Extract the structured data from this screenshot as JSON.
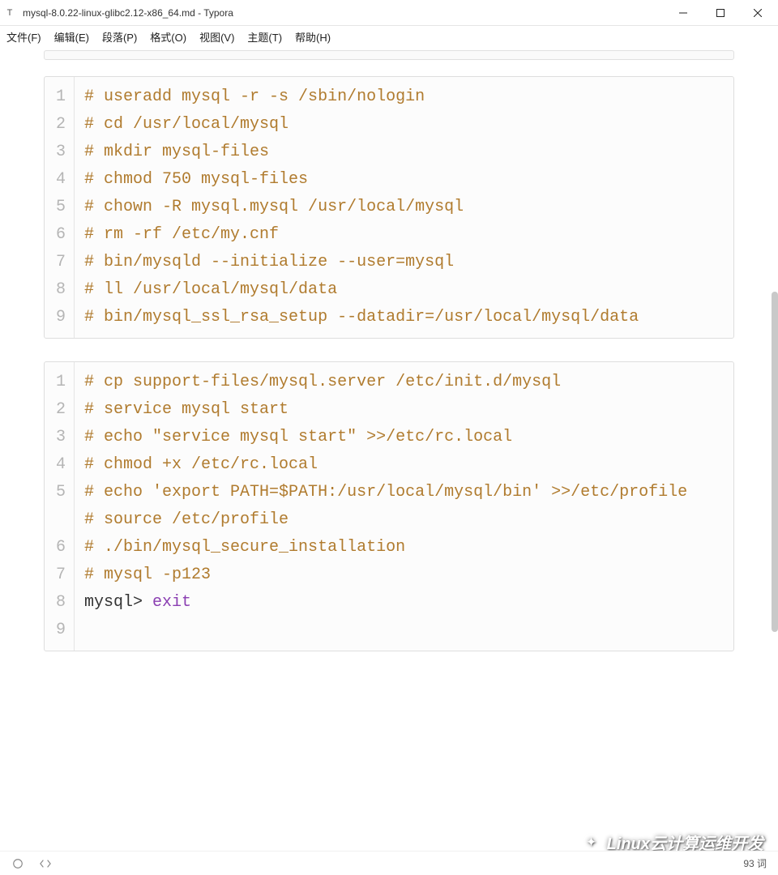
{
  "window": {
    "app_icon_label": "T",
    "title": "mysql-8.0.22-linux-glibc2.12-x86_64.md - Typora"
  },
  "menu": {
    "file": "文件(F)",
    "edit": "编辑(E)",
    "paragraph": "段落(P)",
    "format": "格式(O)",
    "view": "视图(V)",
    "theme": "主题(T)",
    "help": "帮助(H)"
  },
  "code_block_1": {
    "gutter": [
      "1",
      "2",
      "3",
      "4",
      "5",
      "6",
      "7",
      "8",
      "9"
    ],
    "lines": [
      {
        "type": "comment",
        "text": "# useradd mysql -r -s /sbin/nologin"
      },
      {
        "type": "comment",
        "text": "# cd /usr/local/mysql"
      },
      {
        "type": "comment",
        "text": "# mkdir mysql-files"
      },
      {
        "type": "comment",
        "text": "# chmod 750 mysql-files"
      },
      {
        "type": "comment",
        "text": "# chown -R mysql.mysql /usr/local/mysql"
      },
      {
        "type": "comment",
        "text": "# rm -rf /etc/my.cnf"
      },
      {
        "type": "comment",
        "text": "# bin/mysqld --initialize --user=mysql"
      },
      {
        "type": "comment",
        "text": "# ll /usr/local/mysql/data"
      },
      {
        "type": "comment",
        "text": "# bin/mysql_ssl_rsa_setup --datadir=/usr/local/mysql/data"
      }
    ]
  },
  "code_block_2": {
    "gutter": [
      "1",
      "2",
      "3",
      "4",
      "5",
      "",
      "6",
      "7",
      "8",
      "9"
    ],
    "lines": [
      {
        "type": "comment",
        "text": "# cp support-files/mysql.server /etc/init.d/mysql"
      },
      {
        "type": "comment",
        "text": "# service mysql start"
      },
      {
        "type": "comment",
        "text": "# echo \"service mysql start\" >>/etc/rc.local"
      },
      {
        "type": "comment",
        "text": "# chmod +x /etc/rc.local"
      },
      {
        "type": "comment",
        "text": "# echo 'export PATH=$PATH:/usr/local/mysql/bin' >>/etc/profile"
      },
      {
        "type": "comment",
        "text": "# source /etc/profile"
      },
      {
        "type": "comment",
        "text": "# ./bin/mysql_secure_installation"
      },
      {
        "type": "comment",
        "text": "# mysql -p123"
      },
      {
        "type": "mysql",
        "prompt": "mysql> ",
        "cmd": "exit"
      }
    ]
  },
  "statusbar": {
    "word_count": "93 词"
  },
  "watermark": {
    "text": "Linux云计算运维开发"
  }
}
